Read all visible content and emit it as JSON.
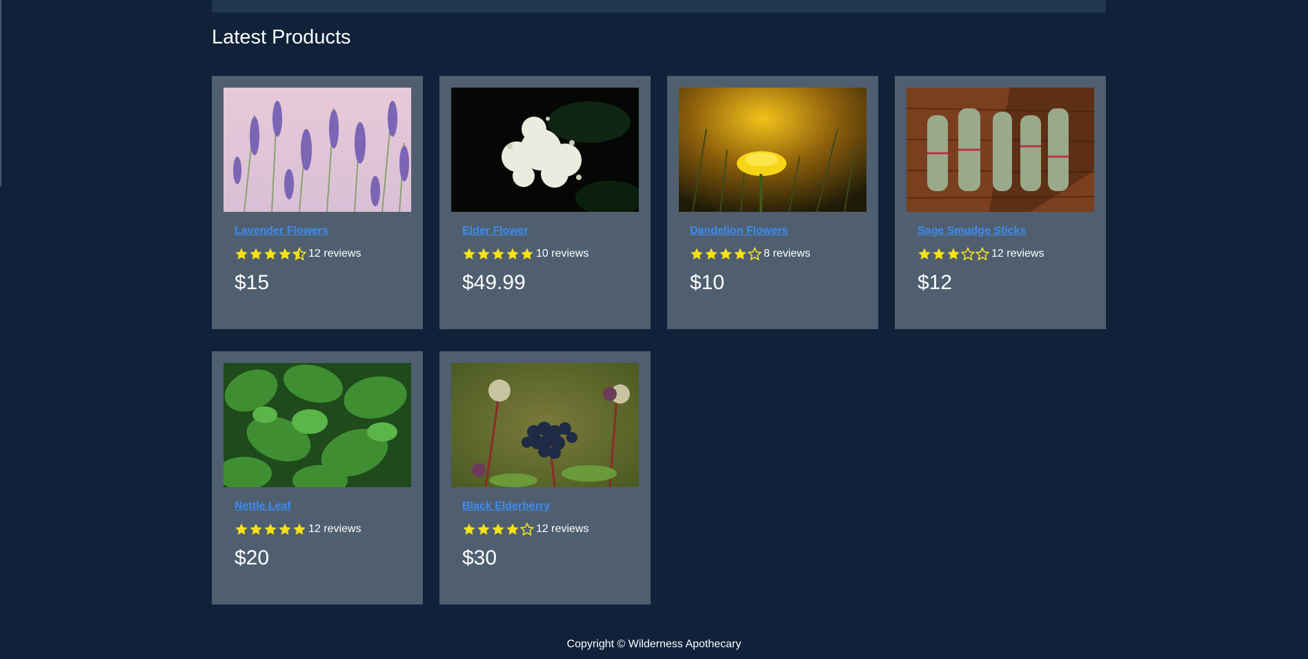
{
  "section_title": "Latest Products",
  "products": [
    {
      "name": "Lavender Flowers",
      "rating": 4.5,
      "reviews": "12 reviews",
      "price": "$15",
      "image": "lavender-photo"
    },
    {
      "name": "Elder Flower",
      "rating": 5,
      "reviews": "10 reviews",
      "price": "$49.99",
      "image": "elderflower-photo"
    },
    {
      "name": "Dandelion Flowers",
      "rating": 4,
      "reviews": "8 reviews",
      "price": "$10",
      "image": "dandelion-photo"
    },
    {
      "name": "Sage Smudge Sticks",
      "rating": 3,
      "reviews": "12 reviews",
      "price": "$12",
      "image": "sage-photo"
    },
    {
      "name": "Nettle Leaf",
      "rating": 5,
      "reviews": "12 reviews",
      "price": "$20",
      "image": "nettle-photo"
    },
    {
      "name": "Black Elderberry",
      "rating": 4,
      "reviews": "12 reviews",
      "price": "$30",
      "image": "elderberry-photo"
    }
  ],
  "footer": {
    "copyright": "Copyright © Wilderness Apothecary"
  },
  "colors": {
    "background": "#0f2239",
    "card": "#4f5f70",
    "link": "#3d8cf0",
    "star": "#f7e11a"
  }
}
